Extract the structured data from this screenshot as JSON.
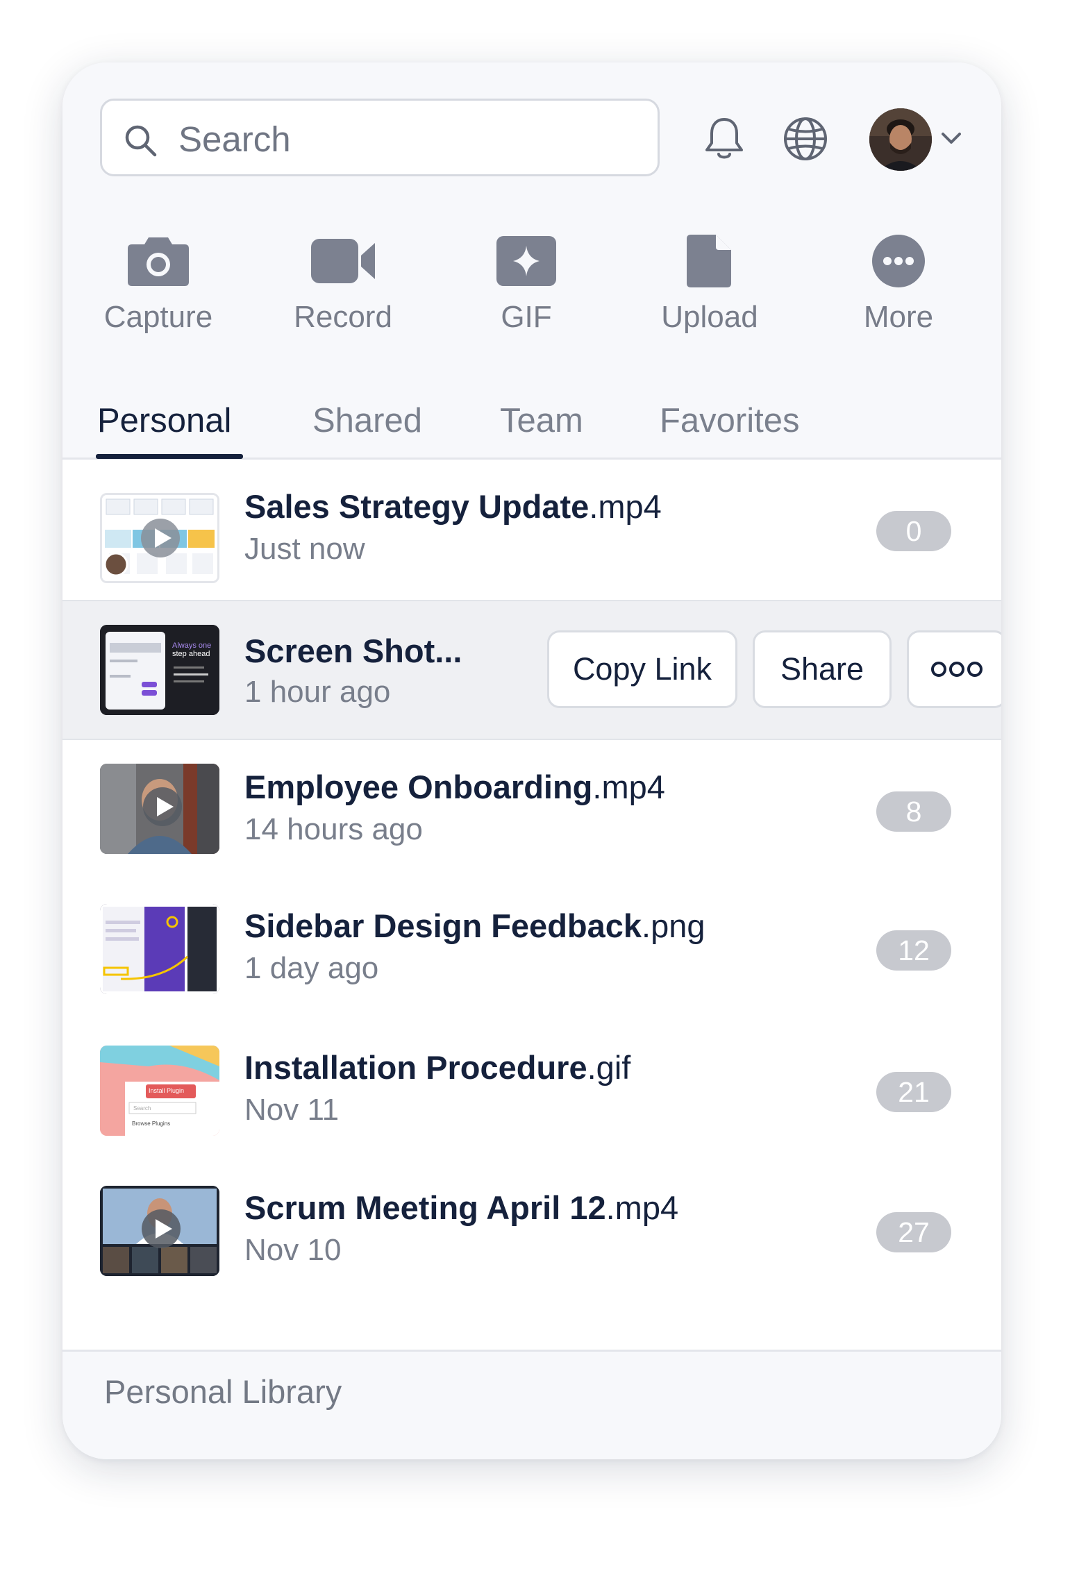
{
  "search": {
    "placeholder": "Search",
    "value": ""
  },
  "header": {
    "icons": [
      "bell-icon",
      "globe-icon",
      "avatar",
      "chevron-down-icon"
    ]
  },
  "actions": [
    {
      "label": "Capture",
      "icon": "camera-icon"
    },
    {
      "label": "Record",
      "icon": "video-camera-icon"
    },
    {
      "label": "GIF",
      "icon": "gif-sparkle-icon"
    },
    {
      "label": "Upload",
      "icon": "file-icon"
    },
    {
      "label": "More",
      "icon": "more-dots-icon"
    }
  ],
  "tabs": [
    {
      "label": "Personal",
      "active": true
    },
    {
      "label": "Shared",
      "active": false
    },
    {
      "label": "Team",
      "active": false
    },
    {
      "label": "Favorites",
      "active": false
    }
  ],
  "items": [
    {
      "name": "Sales Strategy Update",
      "ext": ".mp4",
      "time": "Just now",
      "count": "0"
    },
    {
      "name": "Screen Shot...",
      "ext": "",
      "time": "1 hour ago",
      "count": ""
    },
    {
      "name": "Employee Onboarding",
      "ext": ".mp4",
      "time": "14 hours ago",
      "count": "8"
    },
    {
      "name": "Sidebar Design Feedback",
      "ext": ".png",
      "time": "1 day ago",
      "count": "12"
    },
    {
      "name": "Installation Procedure",
      "ext": ".gif",
      "time": "Nov 11",
      "count": "21"
    },
    {
      "name": "Scrum Meeting April 12",
      "ext": ".mp4",
      "time": "Nov 10",
      "count": "27"
    }
  ],
  "row_actions": {
    "copy_link": "Copy Link",
    "share": "Share",
    "more": "ooo"
  },
  "thumb_text": {
    "screenshot_heading_1": "Always one",
    "screenshot_heading_2": "step ahead",
    "install_button": "Install Plugin",
    "install_search": "Search",
    "install_browse": "Browse Plugins"
  },
  "footer": {
    "label": "Personal Library"
  },
  "colors": {
    "accent": "#15213c",
    "icon_gray": "#7c8190",
    "badge": "#c7c9cf",
    "hover_row": "#eff0f3"
  }
}
